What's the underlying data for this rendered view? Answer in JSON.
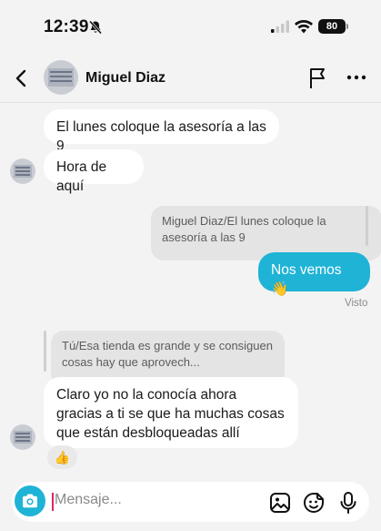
{
  "status_bar": {
    "time": "12:39",
    "battery_level": "80",
    "icons": [
      "bell-slash-icon",
      "signal-icon",
      "wifi-icon",
      "battery-icon"
    ]
  },
  "header": {
    "contact_name": "Miguel Diaz",
    "icons": [
      "back-icon",
      "flag-icon",
      "more-icon"
    ]
  },
  "messages": [
    {
      "direction": "incoming",
      "text": "El lunes coloque la asesoría a las 9"
    },
    {
      "direction": "incoming",
      "text": "Hora de aquí"
    },
    {
      "direction": "outgoing",
      "reply_to": "Miguel Diaz/El lunes coloque la asesoría a las 9",
      "text": "Nos vemos 👋",
      "status": "Visto"
    },
    {
      "direction": "incoming",
      "reply_to": "Tú/Esa tienda es grande y se consiguen cosas hay que aprovech...",
      "text": "Claro yo no la conocía ahora gracias a ti se que ha muchas cosas que están desbloqueadas allí",
      "reaction": "👍"
    }
  ],
  "composer": {
    "placeholder": "Mensaje...",
    "icons": [
      "camera-icon",
      "gallery-icon",
      "sticker-icon",
      "microphone-icon"
    ]
  },
  "colors": {
    "accent": "#1fb3d6",
    "background": "#f3f3f3",
    "incoming_bubble": "#ffffff",
    "reply_preview": "#e4e4e4",
    "caret": "#e2245f"
  }
}
